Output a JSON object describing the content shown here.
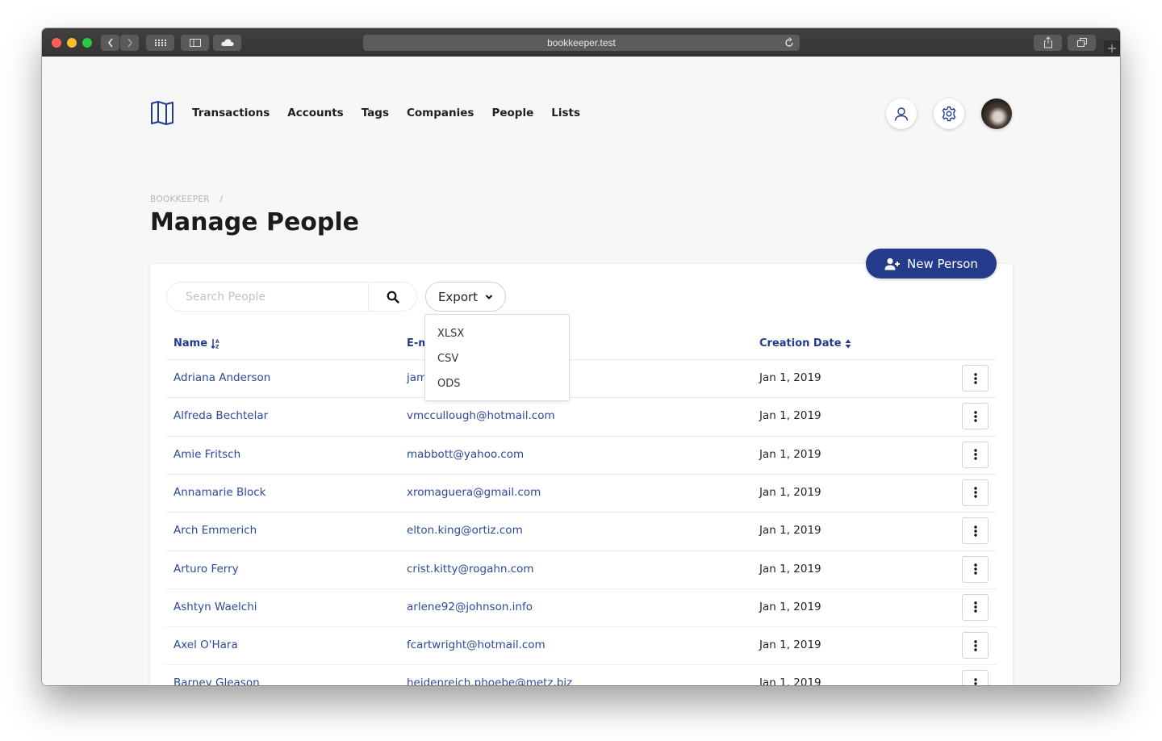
{
  "browser": {
    "url": "bookkeeper.test"
  },
  "nav": {
    "items": [
      "Transactions",
      "Accounts",
      "Tags",
      "Companies",
      "People",
      "Lists"
    ]
  },
  "breadcrumb": {
    "root": "BOOKKEEPER",
    "separator": "/"
  },
  "page": {
    "title": "Manage People",
    "new_button_label": "New Person"
  },
  "toolbar": {
    "search_placeholder": "Search People",
    "export_label": "Export",
    "export_options": [
      "XLSX",
      "CSV",
      "ODS"
    ]
  },
  "table": {
    "headers": {
      "name": "Name",
      "email": "E-m",
      "creation_date": "Creation Date"
    },
    "rows": [
      {
        "name": "Adriana Anderson",
        "email": "jam",
        "date": "Jan 1, 2019"
      },
      {
        "name": "Alfreda Bechtelar",
        "email": "vmccullough@hotmail.com",
        "date": "Jan 1, 2019"
      },
      {
        "name": "Amie Fritsch",
        "email": "mabbott@yahoo.com",
        "date": "Jan 1, 2019"
      },
      {
        "name": "Annamarie Block",
        "email": "xromaguera@gmail.com",
        "date": "Jan 1, 2019"
      },
      {
        "name": "Arch Emmerich",
        "email": "elton.king@ortiz.com",
        "date": "Jan 1, 2019"
      },
      {
        "name": "Arturo Ferry",
        "email": "crist.kitty@rogahn.com",
        "date": "Jan 1, 2019"
      },
      {
        "name": "Ashtyn Waelchi",
        "email": "arlene92@johnson.info",
        "date": "Jan 1, 2019"
      },
      {
        "name": "Axel O'Hara",
        "email": "fcartwright@hotmail.com",
        "date": "Jan 1, 2019"
      },
      {
        "name": "Barney Gleason",
        "email": "heidenreich.phoebe@metz.biz",
        "date": "Jan 1, 2019"
      }
    ]
  },
  "colors": {
    "primary": "#243b8c",
    "link": "#2b4a9a",
    "text": "#1b1b1b",
    "muted": "#b4b4b4"
  }
}
